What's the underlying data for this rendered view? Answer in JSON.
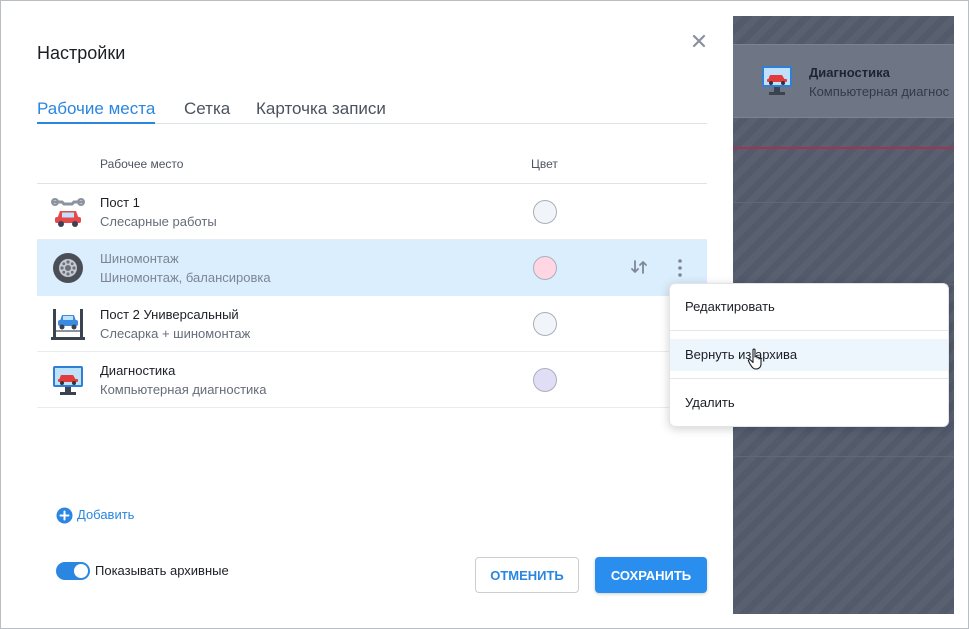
{
  "dialog": {
    "title": "Настройки",
    "tabs": [
      {
        "label": "Рабочие места",
        "active": true
      },
      {
        "label": "Сетка",
        "active": false
      },
      {
        "label": "Карточка записи",
        "active": false
      }
    ],
    "columns": {
      "workplace": "Рабочее место",
      "color": "Цвет"
    },
    "rows": [
      {
        "name": "Пост 1",
        "description": "Слесарные работы",
        "icon": "repair-car-icon",
        "color": "#f1f4f8"
      },
      {
        "name": "Шиномонтаж",
        "description": "Шиномонтаж, балансировка",
        "icon": "tire-icon",
        "color": "#ffd6e2",
        "archived": true,
        "selected": true
      },
      {
        "name": "Пост 2 Универсальный",
        "description": "Слесарка + шиномонтаж",
        "icon": "car-lift-icon",
        "color": "#f1f4f8"
      },
      {
        "name": "Диагностика",
        "description": "Компьютерная диагностика",
        "icon": "diagnostics-monitor-icon",
        "color": "#e2ddf6"
      }
    ],
    "context_menu": {
      "items": [
        {
          "label": "Редактировать"
        },
        {
          "label": "Вернуть из архива",
          "hover": true
        },
        {
          "label": "Удалить"
        }
      ]
    },
    "add_label": "Добавить",
    "show_archived_label": "Показывать архивные",
    "show_archived": true,
    "cancel_label": "ОТМЕНИТЬ",
    "save_label": "СОХРАНИТЬ"
  },
  "background_app": {
    "card": {
      "title": "Диагностика",
      "subtitle": "Компьютерная диагнос"
    }
  },
  "colors": {
    "accent": "#2a86e0",
    "selected_row": "#dbeefe",
    "overlay": "#525a6b"
  }
}
